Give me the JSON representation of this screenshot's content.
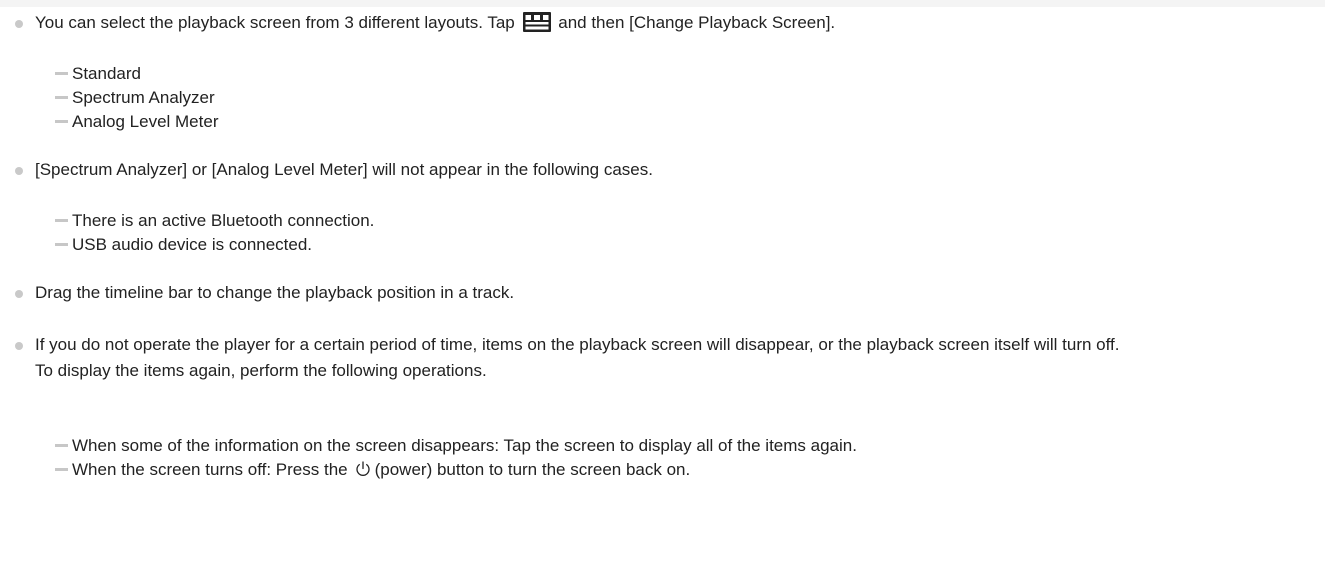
{
  "notes": [
    {
      "text_before": "You can select the playback screen from 3 different layouts. Tap",
      "icon": "options-menu-icon",
      "text_after": "and then [Change Playback Screen].",
      "sub_items": [
        "Standard",
        "Spectrum Analyzer",
        "Analog Level Meter"
      ]
    },
    {
      "text": "[Spectrum Analyzer] or [Analog Level Meter] will not appear in the following cases.",
      "sub_items": [
        "There is an active Bluetooth connection.",
        "USB audio device is connected."
      ]
    },
    {
      "text": "Drag the timeline bar to change the playback position in a track."
    },
    {
      "text": "If you do not operate the player for a certain period of time, items on the playback screen will disappear, or the playback screen itself will turn off.",
      "text_line2": "To display the items again, perform the following operations.",
      "sub_items": [
        "When some of the information on the screen disappears: Tap the screen to display all of the items again."
      ],
      "last_sub": {
        "before": "When the screen turns off: Press the",
        "icon": "power-icon",
        "after": "(power) button to turn the screen back on."
      }
    }
  ],
  "colors": {
    "text": "#222222",
    "bullet": "#c9c9c9",
    "dash": "#c7c7c7",
    "icon": "#222222"
  }
}
